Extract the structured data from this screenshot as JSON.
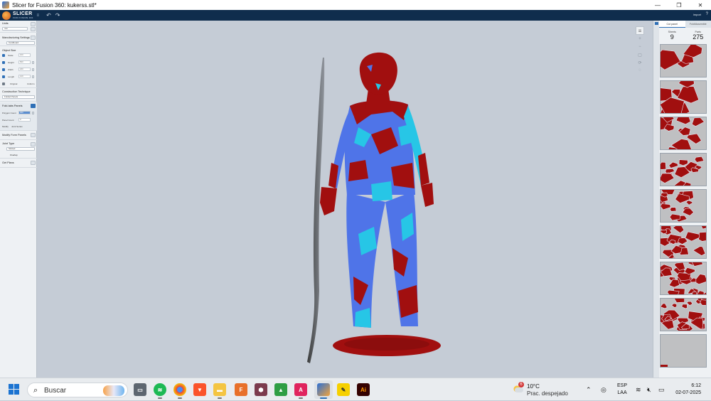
{
  "window": {
    "title": "Slicer for Fusion 360: kukerss.stl*",
    "minimize": "—",
    "maximize": "❐",
    "close": "✕"
  },
  "menubar": {
    "logo_text": "SLICER",
    "logo_sub": "FOR FUSION 360",
    "menu_icon": "≡",
    "undo": "↶",
    "redo": "↷",
    "import": "Import",
    "help": "?"
  },
  "left_panel": {
    "units_label": "Units",
    "units_value": "mm",
    "manufacturing_label": "Manufacturing Settings",
    "manufacturing_value": "Cardboard",
    "object_size_label": "Object Size",
    "scale_label": "Scale",
    "scale_value": "100",
    "height_label": "Height",
    "height_value": "500",
    "width_label": "Width",
    "width_value": "220",
    "length_label": "Length",
    "length_value": "120",
    "original_label": "Original",
    "original_value": "",
    "uniform_label": "Uniform",
    "construction_label": "Construction Technique",
    "construction_value": "Folded Panels",
    "folded_label": "Fold-tabs Panels",
    "polygon_count_label": "Polygon Count",
    "polygon_count_value": "300",
    "panel_count_label": "Panel Count",
    "panel_count_value": "9",
    "modify_label": "Modify",
    "modify_value": "Joint Series",
    "modify_form_label": "Modify Form Panels",
    "joint_type_label": "Joint Type",
    "joint_type_value": "Slotted",
    "joint_type_sub": "Overlap",
    "get_plans_label": "Get Plans"
  },
  "right_panel": {
    "tab_active": "Cut panel",
    "tab_inactive": "Fold/Assemble",
    "sheets_label": "Sheets",
    "sheets_value": "9",
    "parts_label": "Parts",
    "parts_value": "275",
    "thumbnail_count": 9
  },
  "taskbar": {
    "search_placeholder": "Buscar",
    "weather_badge": "6",
    "temperature": "10°C",
    "condition": "Prac. despejado",
    "lang_primary": "ESP",
    "lang_secondary": "LAA",
    "time": "6:12",
    "date": "02-07-2025"
  },
  "colors": {
    "menubar": "#0f2d4d",
    "accent": "#2e6fb6",
    "panel_red": "#a10f0f",
    "panel_cyan": "#27c6e6",
    "panel_blue": "#4f74e8",
    "viewport": "#c5ccd6"
  }
}
